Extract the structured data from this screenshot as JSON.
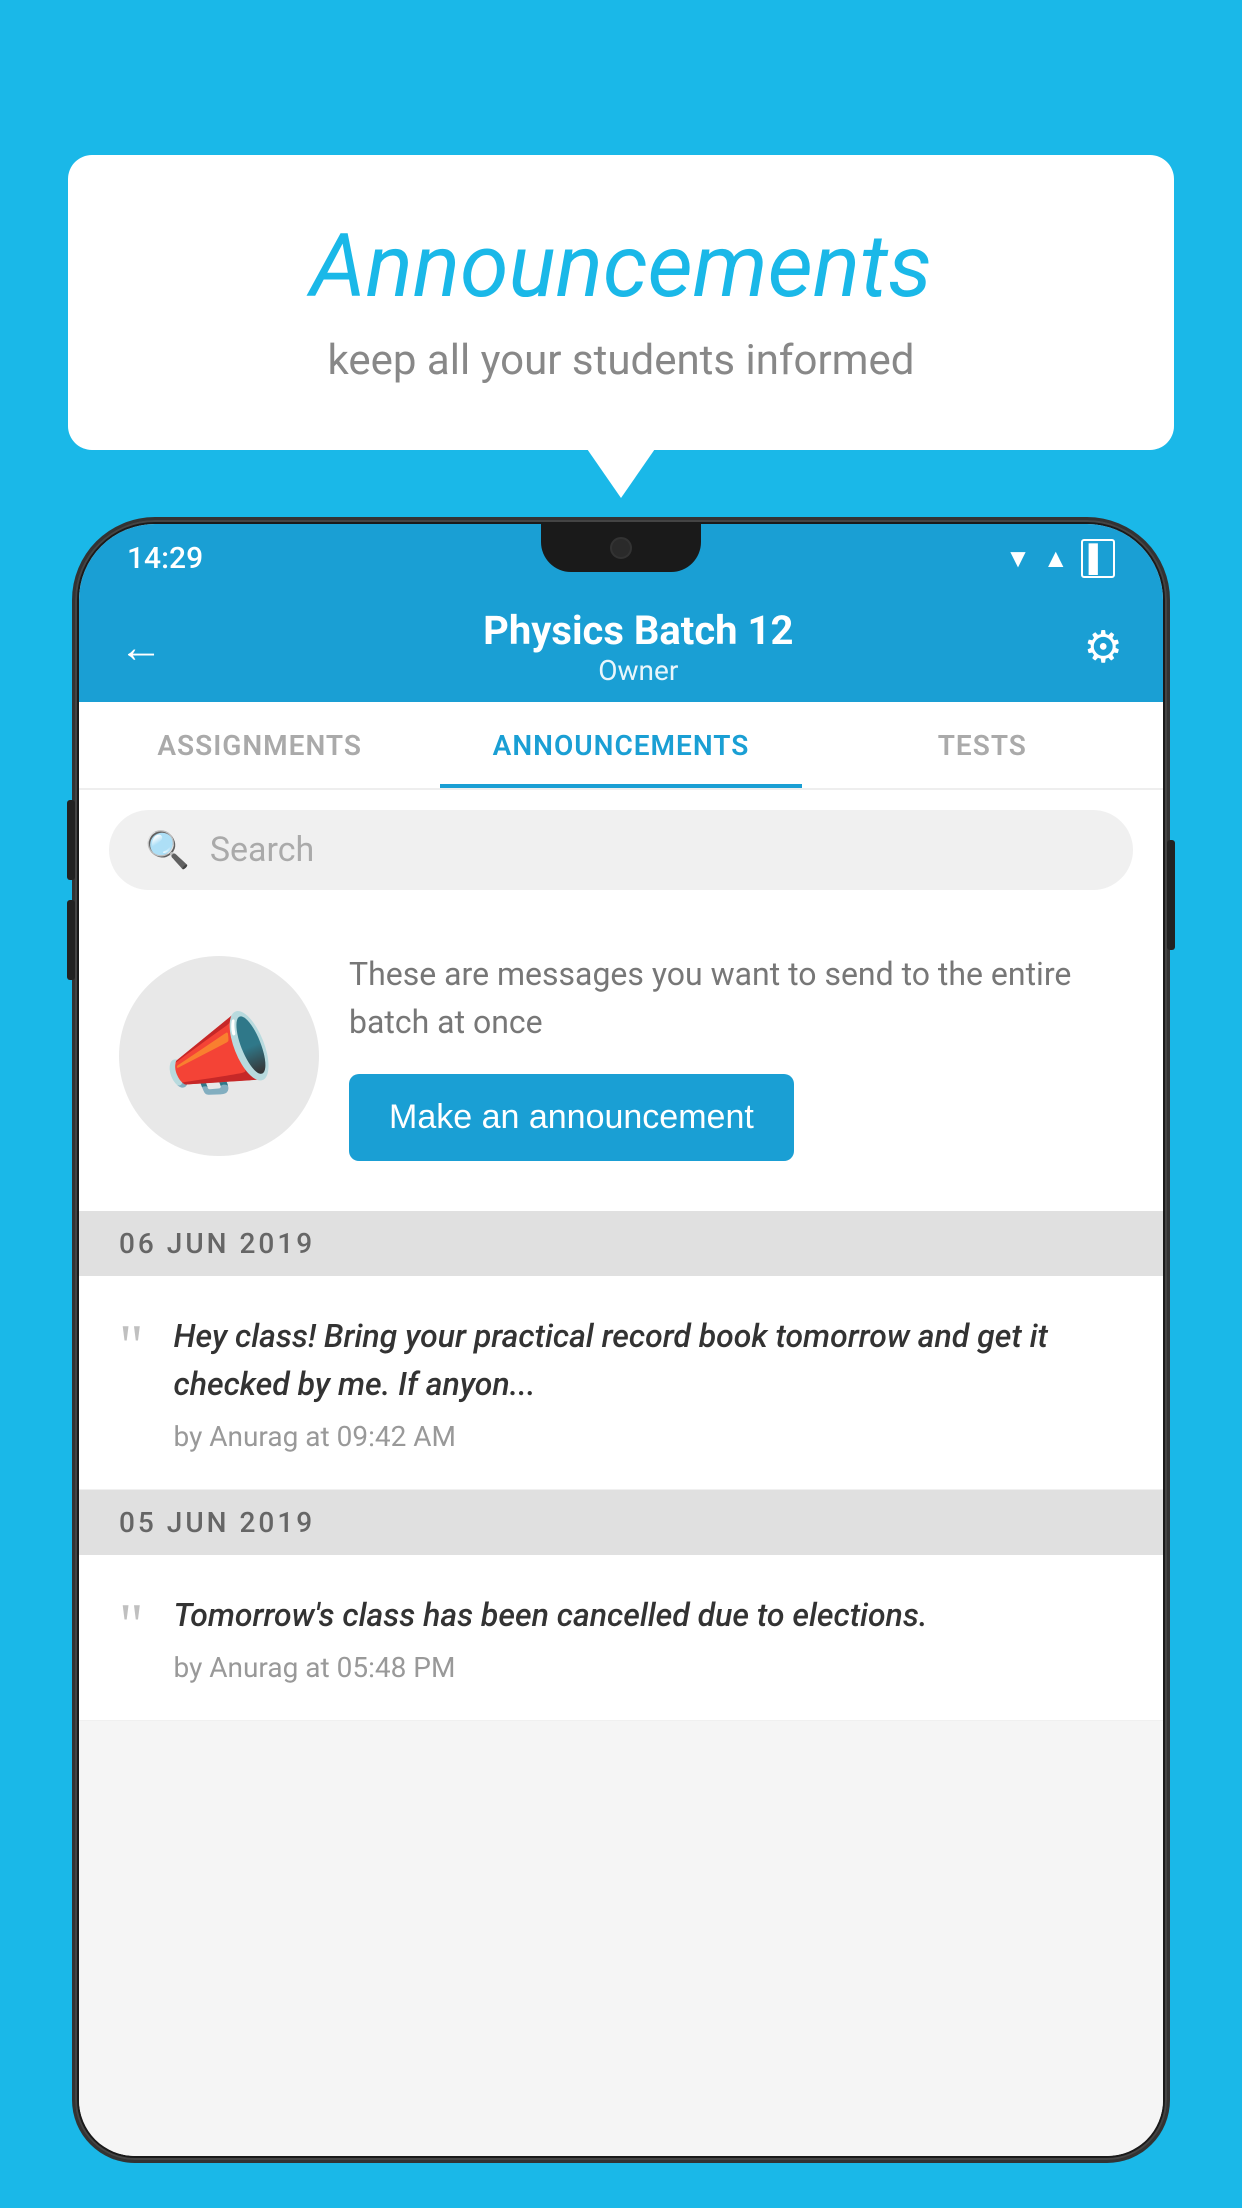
{
  "background_color": "#1ab8e8",
  "speech_bubble": {
    "title": "Announcements",
    "subtitle": "keep all your students informed"
  },
  "phone": {
    "status_bar": {
      "time": "14:29"
    },
    "app_bar": {
      "title": "Physics Batch 12",
      "subtitle": "Owner",
      "back_icon": "←",
      "settings_icon": "⚙"
    },
    "tabs": [
      {
        "label": "ASSIGNMENTS",
        "active": false
      },
      {
        "label": "ANNOUNCEMENTS",
        "active": true
      },
      {
        "label": "TESTS",
        "active": false
      }
    ],
    "search": {
      "placeholder": "Search"
    },
    "promo": {
      "description": "These are messages you want to send to the entire batch at once",
      "button_label": "Make an announcement"
    },
    "announcements": [
      {
        "date": "06  JUN  2019",
        "message": "Hey class! Bring your practical record book tomorrow and get it checked by me. If anyon...",
        "meta": "by Anurag at 09:42 AM"
      },
      {
        "date": "05  JUN  2019",
        "message": "Tomorrow's class has been cancelled due to elections.",
        "meta": "by Anurag at 05:48 PM"
      }
    ]
  }
}
